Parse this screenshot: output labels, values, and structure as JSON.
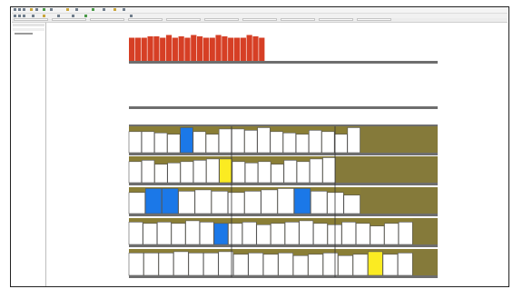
{
  "colors": {
    "red_bar": "#d63f25",
    "olive": "#8a7e36",
    "olive_bg": "#857a3a",
    "blue": "#1b78e8",
    "yellow": "#fbeb22",
    "gray_line": "#6e6e6e",
    "white": "#ffffff"
  },
  "toolbar": {
    "icons": [
      "file-icon",
      "save-icon",
      "print-icon",
      "zoom-icon",
      "search-icon",
      "chart-icon",
      "settings-icon",
      "grid-icon"
    ]
  },
  "tabs": {
    "count": 10
  },
  "chart_data": {
    "type": "bar",
    "top_series": {
      "name": "",
      "values": [
        0.85,
        0.85,
        0.85,
        0.9,
        0.9,
        0.85,
        0.95,
        0.85,
        0.9,
        0.85,
        0.95,
        0.9,
        0.85,
        0.85,
        0.95,
        0.9,
        0.85,
        0.85,
        0.85,
        0.95,
        0.9,
        0.85
      ]
    },
    "rows": [
      {
        "bars": [
          {
            "v": 0.8,
            "c": "white"
          },
          {
            "v": 0.8,
            "c": "white"
          },
          {
            "v": 0.75,
            "c": "white"
          },
          {
            "v": 0.7,
            "c": "white"
          },
          {
            "v": 0.95,
            "c": "blue"
          },
          {
            "v": 0.8,
            "c": "white"
          },
          {
            "v": 0.7,
            "c": "white"
          },
          {
            "v": 0.9,
            "c": "white"
          },
          {
            "v": 0.9,
            "c": "white"
          },
          {
            "v": 0.85,
            "c": "white"
          },
          {
            "v": 0.95,
            "c": "white"
          },
          {
            "v": 0.8,
            "c": "white"
          },
          {
            "v": 0.75,
            "c": "white"
          },
          {
            "v": 0.7,
            "c": "white"
          },
          {
            "v": 0.85,
            "c": "white"
          },
          {
            "v": 0.8,
            "c": "white"
          },
          {
            "v": 0.7,
            "c": "white"
          },
          {
            "v": 0.95,
            "c": "white"
          }
        ],
        "olive_start": 0.75
      },
      {
        "bars": [
          {
            "v": 0.8,
            "c": "white"
          },
          {
            "v": 0.85,
            "c": "white"
          },
          {
            "v": 0.7,
            "c": "white"
          },
          {
            "v": 0.75,
            "c": "white"
          },
          {
            "v": 0.8,
            "c": "white"
          },
          {
            "v": 0.85,
            "c": "white"
          },
          {
            "v": 0.9,
            "c": "white"
          },
          {
            "v": 0.9,
            "c": "yellow"
          },
          {
            "v": 0.8,
            "c": "white"
          },
          {
            "v": 0.75,
            "c": "white"
          },
          {
            "v": 0.8,
            "c": "white"
          },
          {
            "v": 0.7,
            "c": "white"
          },
          {
            "v": 0.85,
            "c": "white"
          },
          {
            "v": 0.8,
            "c": "white"
          },
          {
            "v": 0.9,
            "c": "white"
          },
          {
            "v": 0.95,
            "c": "white"
          }
        ],
        "olive_start": 0.67
      },
      {
        "bars": [
          {
            "v": 0.8,
            "c": "white"
          },
          {
            "v": 0.95,
            "c": "blue"
          },
          {
            "v": 0.95,
            "c": "blue"
          },
          {
            "v": 0.85,
            "c": "white"
          },
          {
            "v": 0.9,
            "c": "white"
          },
          {
            "v": 0.85,
            "c": "white"
          },
          {
            "v": 0.8,
            "c": "white"
          },
          {
            "v": 0.85,
            "c": "white"
          },
          {
            "v": 0.9,
            "c": "white"
          },
          {
            "v": 0.95,
            "c": "white"
          },
          {
            "v": 0.95,
            "c": "blue"
          },
          {
            "v": 0.85,
            "c": "white"
          },
          {
            "v": 0.8,
            "c": "white"
          },
          {
            "v": 0.7,
            "c": "white"
          }
        ],
        "olive_start": 0.75
      },
      {
        "bars": [
          {
            "v": 0.85,
            "c": "white"
          },
          {
            "v": 0.8,
            "c": "white"
          },
          {
            "v": 0.85,
            "c": "white"
          },
          {
            "v": 0.8,
            "c": "white"
          },
          {
            "v": 0.9,
            "c": "white"
          },
          {
            "v": 0.85,
            "c": "white"
          },
          {
            "v": 0.8,
            "c": "blue"
          },
          {
            "v": 0.8,
            "c": "white"
          },
          {
            "v": 0.85,
            "c": "white"
          },
          {
            "v": 0.75,
            "c": "white"
          },
          {
            "v": 0.8,
            "c": "white"
          },
          {
            "v": 0.85,
            "c": "white"
          },
          {
            "v": 0.9,
            "c": "white"
          },
          {
            "v": 0.8,
            "c": "white"
          },
          {
            "v": 0.75,
            "c": "white"
          },
          {
            "v": 0.85,
            "c": "white"
          },
          {
            "v": 0.8,
            "c": "white"
          },
          {
            "v": 0.7,
            "c": "white"
          },
          {
            "v": 0.8,
            "c": "white"
          },
          {
            "v": 0.85,
            "c": "white"
          }
        ],
        "olive_start": 0.92
      },
      {
        "bars": [
          {
            "v": 0.85,
            "c": "white"
          },
          {
            "v": 0.85,
            "c": "white"
          },
          {
            "v": 0.85,
            "c": "white"
          },
          {
            "v": 0.9,
            "c": "white"
          },
          {
            "v": 0.85,
            "c": "white"
          },
          {
            "v": 0.85,
            "c": "white"
          },
          {
            "v": 0.9,
            "c": "white"
          },
          {
            "v": 0.8,
            "c": "white"
          },
          {
            "v": 0.85,
            "c": "white"
          },
          {
            "v": 0.8,
            "c": "white"
          },
          {
            "v": 0.85,
            "c": "white"
          },
          {
            "v": 0.75,
            "c": "white"
          },
          {
            "v": 0.8,
            "c": "white"
          },
          {
            "v": 0.85,
            "c": "white"
          },
          {
            "v": 0.75,
            "c": "white"
          },
          {
            "v": 0.8,
            "c": "white"
          },
          {
            "v": 0.9,
            "c": "yellow"
          },
          {
            "v": 0.8,
            "c": "white"
          },
          {
            "v": 0.85,
            "c": "white"
          }
        ],
        "olive_start": 0.92
      }
    ]
  }
}
